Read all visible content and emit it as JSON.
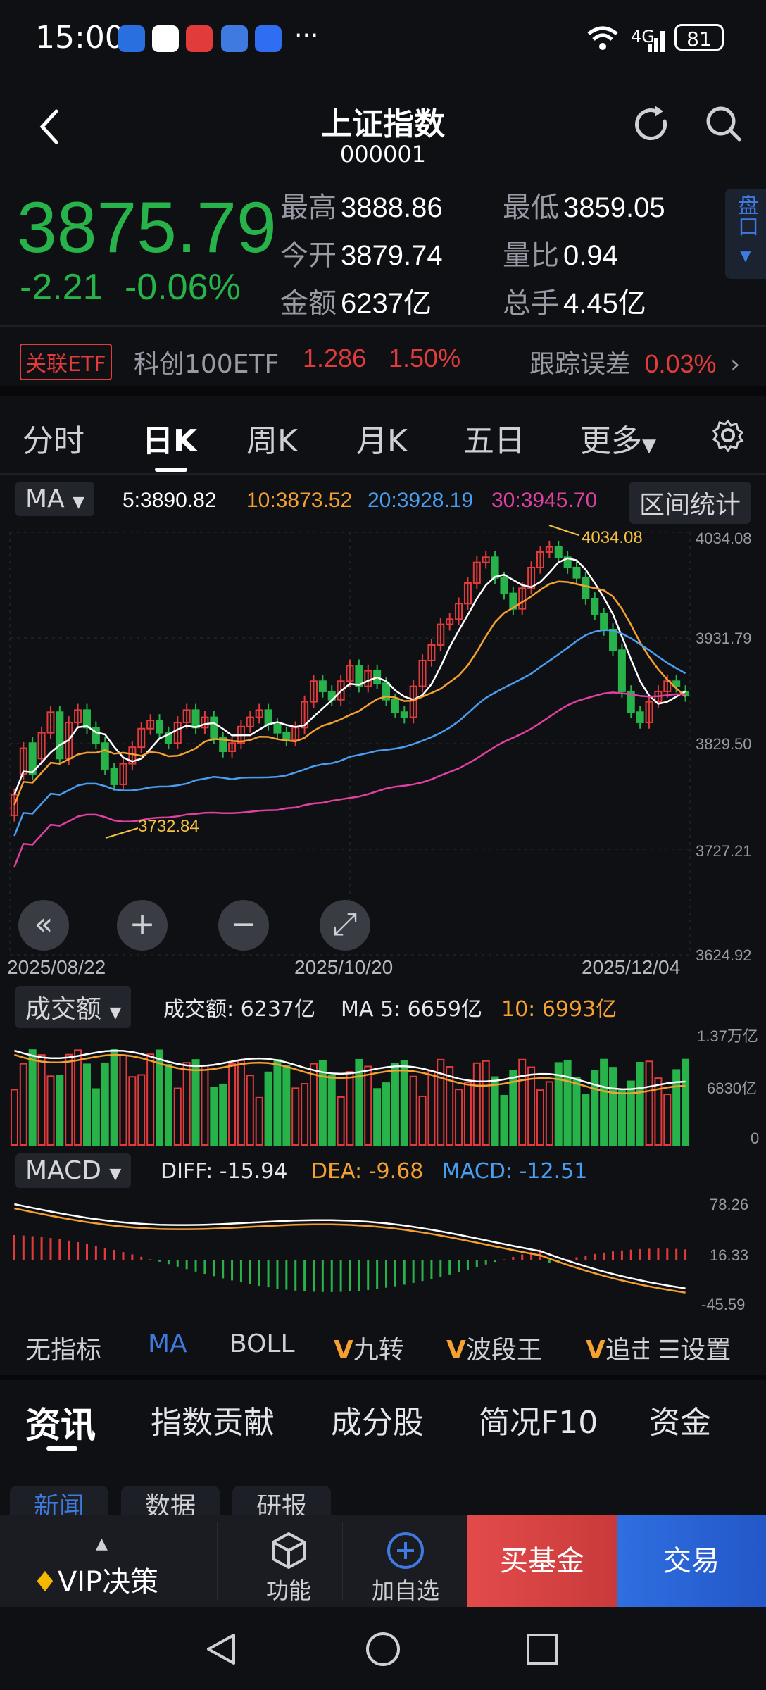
{
  "status_bar": {
    "time": "15:00",
    "more": "···",
    "network": "4G",
    "battery": "81"
  },
  "header": {
    "title": "上证指数",
    "code": "000001"
  },
  "quote": {
    "price": "3875.79",
    "change": "-2.21",
    "change_pct": "-0.06%",
    "high_label": "最高",
    "high": "3888.86",
    "low_label": "最低",
    "low": "3859.05",
    "open_label": "今开",
    "open": "3879.74",
    "vol_ratio_label": "量比",
    "vol_ratio": "0.94",
    "amount_label": "金额",
    "amount": "6237亿",
    "hands_label": "总手",
    "hands": "4.45亿",
    "pankou": "盘口"
  },
  "etf": {
    "tag": "关联ETF",
    "name": "科创100ETF",
    "price": "1.286",
    "pct": "1.50%",
    "track_label": "跟踪误差",
    "track_value": "0.03%"
  },
  "period_tabs": [
    "分时",
    "日K",
    "周K",
    "月K",
    "五日",
    "更多"
  ],
  "ma_bar": {
    "selector": "MA",
    "ma5": "5:3890.82",
    "ma10": "10:3873.52",
    "ma20": "20:3928.19",
    "ma30": "30:3945.70",
    "range_stats": "区间统计"
  },
  "colors": {
    "up": "#e23b3b",
    "down": "#27b24a",
    "ma5": "#ffffff",
    "ma10": "#f5a030",
    "ma20": "#4a9ef0",
    "ma30": "#e040a0"
  },
  "chart_data": [
    {
      "type": "candlestick",
      "y_ticks": [
        "4034.08",
        "3931.79",
        "3829.50",
        "3727.21",
        "3624.92"
      ],
      "ylim": [
        3624.92,
        4034.08
      ],
      "x_ticks": [
        "2025/08/22",
        "2025/10/20",
        "2025/12/04"
      ],
      "max_label": "4034.08",
      "min_label": "3732.84",
      "close": [
        3780,
        3825,
        3800,
        3840,
        3860,
        3815,
        3850,
        3862,
        3845,
        3830,
        3805,
        3790,
        3810,
        3826,
        3844,
        3852,
        3840,
        3830,
        3850,
        3862,
        3845,
        3855,
        3835,
        3822,
        3830,
        3846,
        3855,
        3862,
        3848,
        3840,
        3833,
        3845,
        3870,
        3890,
        3880,
        3872,
        3890,
        3905,
        3885,
        3900,
        3888,
        3872,
        3860,
        3855,
        3885,
        3910,
        3925,
        3945,
        3950,
        3965,
        3985,
        4005,
        4010,
        3990,
        3975,
        3960,
        3980,
        4000,
        4015,
        4020,
        4010,
        4000,
        3990,
        3970,
        3955,
        3940,
        3920,
        3880,
        3860,
        3850,
        3870,
        3880,
        3890,
        3885,
        3876
      ],
      "open": [
        3760,
        3800,
        3830,
        3815,
        3840,
        3860,
        3815,
        3850,
        3862,
        3845,
        3830,
        3805,
        3790,
        3810,
        3826,
        3844,
        3852,
        3840,
        3830,
        3850,
        3862,
        3845,
        3855,
        3835,
        3822,
        3830,
        3846,
        3855,
        3862,
        3848,
        3840,
        3833,
        3845,
        3870,
        3890,
        3880,
        3872,
        3890,
        3905,
        3885,
        3900,
        3888,
        3872,
        3860,
        3855,
        3885,
        3910,
        3925,
        3945,
        3950,
        3965,
        3985,
        4005,
        4010,
        3990,
        3975,
        3960,
        3980,
        4000,
        4015,
        4020,
        4010,
        4000,
        3990,
        3970,
        3955,
        3940,
        3920,
        3880,
        3860,
        3850,
        3870,
        3880,
        3890,
        3880
      ]
    },
    {
      "type": "bar",
      "title": "成交额",
      "label_amount": "成交额: 6237亿",
      "label_ma5": "MA 5: 6659亿",
      "label_ma10": "10: 6993亿",
      "y_ticks": [
        "1.37万亿",
        "6830亿",
        "0"
      ]
    },
    {
      "type": "bar",
      "title": "MACD",
      "diff_label": "DIFF: -15.94",
      "dea_label": "DEA: -9.68",
      "macd_label": "MACD: -12.51",
      "y_ticks": [
        "78.26",
        "16.33",
        "-45.59"
      ]
    }
  ],
  "indicator_bar": [
    "无指标",
    "MA",
    "BOLL",
    "九转",
    "波段王",
    "追击",
    "设置"
  ],
  "bottom_tabs": [
    "资讯",
    "指数贡献",
    "成分股",
    "简况F10",
    "资金"
  ],
  "sub_tabs": [
    "新闻",
    "数据",
    "研报"
  ],
  "action_bar": {
    "vip": "VIP决策",
    "func": "功能",
    "add": "加自选",
    "buy_fund": "买基金",
    "trade": "交易"
  }
}
